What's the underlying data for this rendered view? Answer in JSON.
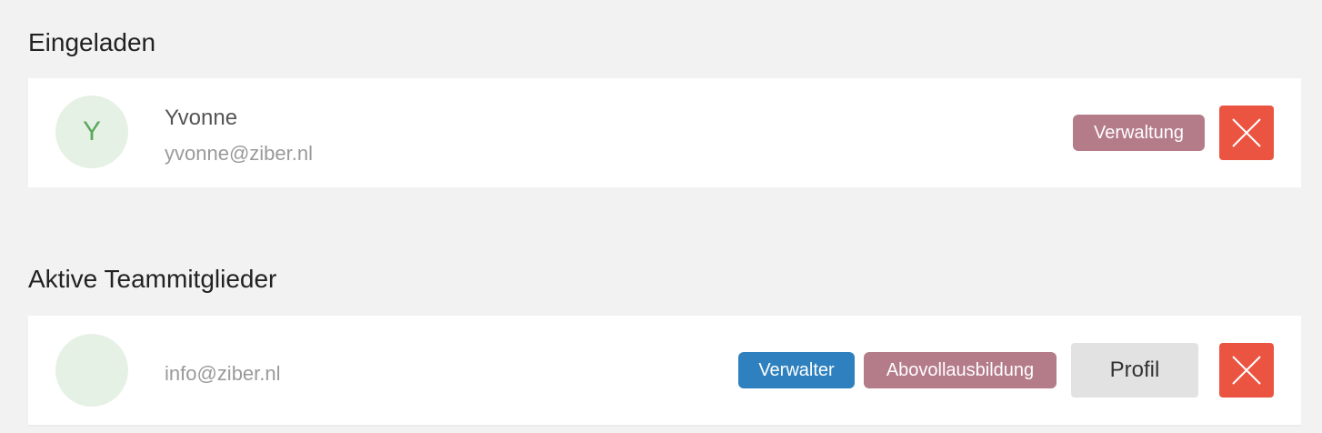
{
  "invited": {
    "title": "Eingeladen",
    "members": [
      {
        "avatar_letter": "Y",
        "name": "Yvonne",
        "email": "yvonne@ziber.nl",
        "tags": [
          "Verwaltung"
        ]
      }
    ]
  },
  "active": {
    "title": "Aktive Teammitglieder",
    "members": [
      {
        "avatar_letter": "",
        "name": "",
        "email": "info@ziber.nl",
        "tags": [
          "Verwalter",
          "Abovollausbildung"
        ],
        "profile_label": "Profil"
      }
    ]
  },
  "colors": {
    "background": "#f2f2f2",
    "role_tag": "#b47b89",
    "admin_tag": "#2e80be",
    "remove_button": "#ea5440",
    "avatar_bg": "#e6f1e5",
    "avatar_letter": "#5aa85c"
  },
  "icons": {
    "remove": "close-icon"
  }
}
